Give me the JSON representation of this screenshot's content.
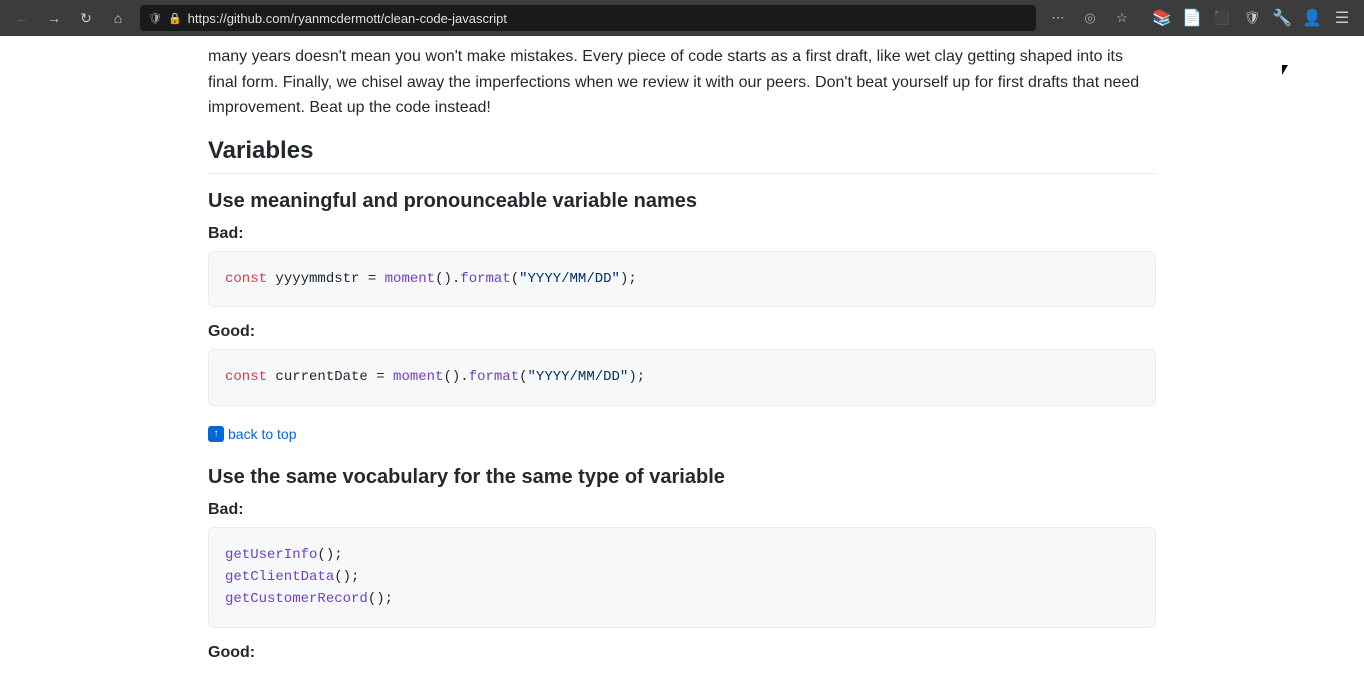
{
  "browser": {
    "url": "https://github.com/ryanmcdermott/clean-code-javascript",
    "back_disabled": false,
    "forward_disabled": false
  },
  "content": {
    "intro_paragraph": "many years doesn't mean you won't make mistakes. Every piece of code starts as a first draft, like wet clay getting shaped into its final form. Finally, we chisel away the imperfections when we review it with our peers. Don't beat yourself up for first drafts that need improvement. Beat up the code instead!",
    "variables_heading": "Variables",
    "section1": {
      "heading": "Use meaningful and pronounceable variable names",
      "bad_label": "Bad:",
      "bad_code": "const yyyymmdstr = moment().format(\"YYYY/MM/DD\");",
      "good_label": "Good:",
      "good_code": "const currentDate = moment().format(\"YYYY/MM/DD\");"
    },
    "back_to_top_label": "back to top",
    "section2": {
      "heading": "Use the same vocabulary for the same type of variable",
      "bad_label": "Bad:",
      "bad_code_lines": [
        "getUserInfo();",
        "getClientData();",
        "getCustomerRecord();"
      ],
      "good_label": "Good:"
    }
  },
  "icons": {
    "back": "←",
    "forward": "→",
    "refresh": "↻",
    "home": "⌂",
    "lock": "🔒",
    "shield": "🛡",
    "more": "…",
    "arrow_up": "↑",
    "star": "★"
  }
}
